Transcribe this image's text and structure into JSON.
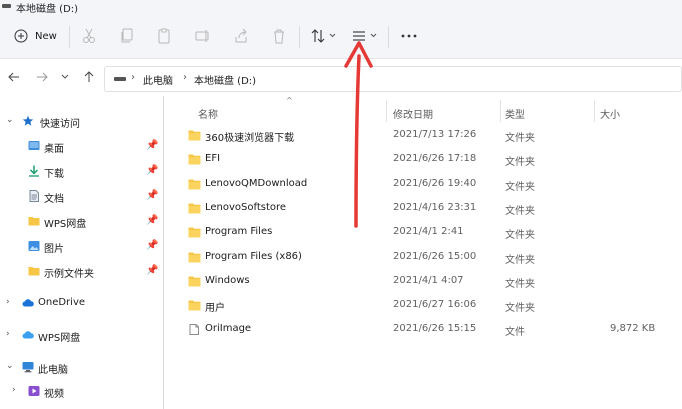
{
  "window": {
    "title": "本地磁盘 (D:)"
  },
  "toolbar": {
    "new_label": "New",
    "icons": [
      "cut-icon",
      "copy-icon",
      "paste-icon",
      "rename-icon",
      "share-icon",
      "delete-icon",
      "sort-icon",
      "view-icon",
      "more-icon"
    ]
  },
  "address": {
    "crumbs": [
      "此电脑",
      "本地磁盘 (D:)"
    ]
  },
  "sidebar": {
    "items": [
      {
        "label": "快速访问",
        "icon": "star-icon"
      },
      {
        "label": "桌面",
        "icon": "desktop-icon"
      },
      {
        "label": "下载",
        "icon": "download-icon"
      },
      {
        "label": "文档",
        "icon": "document-icon"
      },
      {
        "label": "WPS网盘",
        "icon": "folder-icon"
      },
      {
        "label": "图片",
        "icon": "pictures-icon"
      },
      {
        "label": "示例文件夹",
        "icon": "folder-icon"
      },
      {
        "label": "OneDrive",
        "icon": "cloud-icon"
      },
      {
        "label": "WPS网盘",
        "icon": "cloud-icon"
      },
      {
        "label": "此电脑",
        "icon": "computer-icon"
      },
      {
        "label": "视频",
        "icon": "video-icon"
      }
    ]
  },
  "columns": {
    "name": "名称",
    "date": "修改日期",
    "type": "类型",
    "size": "大小"
  },
  "files": [
    {
      "name": "360极速浏览器下载",
      "date": "2021/7/13 17:26",
      "type": "文件夹",
      "size": ""
    },
    {
      "name": "EFI",
      "date": "2021/6/26 17:18",
      "type": "文件夹",
      "size": ""
    },
    {
      "name": "LenovoQMDownload",
      "date": "2021/6/26 19:40",
      "type": "文件夹",
      "size": ""
    },
    {
      "name": "LenovoSoftstore",
      "date": "2021/4/16 23:31",
      "type": "文件夹",
      "size": ""
    },
    {
      "name": "Program Files",
      "date": "2021/4/1 2:41",
      "type": "文件夹",
      "size": ""
    },
    {
      "name": "Program Files (x86)",
      "date": "2021/6/26 15:00",
      "type": "文件夹",
      "size": ""
    },
    {
      "name": "Windows",
      "date": "2021/4/1 4:07",
      "type": "文件夹",
      "size": ""
    },
    {
      "name": "用户",
      "date": "2021/6/27 16:06",
      "type": "文件夹",
      "size": ""
    },
    {
      "name": "OriImage",
      "date": "2021/6/26 15:15",
      "type": "文件",
      "size": "9,872 KB"
    }
  ],
  "colors": {
    "accent": "#0067c0",
    "folder": "#f7c646",
    "annotation_arrow": "#e53935"
  }
}
